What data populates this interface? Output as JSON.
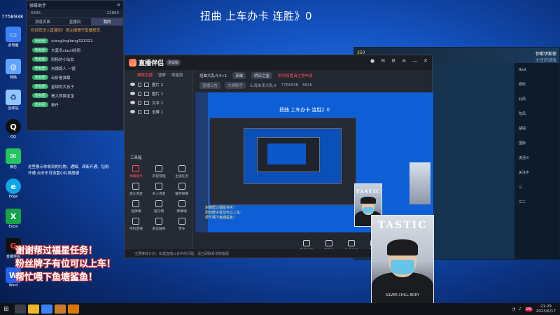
{
  "overlay": {
    "stream_title": "扭曲  上车办卡 连胜》0",
    "room_number_top": "7758938",
    "banner_lines": [
      "谢谢帮过福星任务！",
      "粉丝牌子有位可以上车！",
      "帮忙喂下鱼塘鲨鱼！"
    ]
  },
  "desktop_icons": [
    {
      "label": "此电脑",
      "icon": "computer-icon",
      "color": "#3b82f6"
    },
    {
      "label": "网络",
      "icon": "network-icon",
      "color": "#60a5fa"
    },
    {
      "label": "回收站",
      "icon": "recycle-bin-icon",
      "color": "#93c5fd"
    },
    {
      "label": "QQ",
      "icon": "qq-icon",
      "color": "#111111"
    },
    {
      "label": "微信",
      "icon": "wechat-icon",
      "color": "#22c55e"
    },
    {
      "label": "Edge",
      "icon": "edge-icon",
      "color": "#0ea5e9"
    },
    {
      "label": "Excel",
      "icon": "excel-icon",
      "color": "#16a34a"
    },
    {
      "label": "直播伴侣",
      "icon": "live-icon",
      "color": "#dc2626"
    },
    {
      "label": "Word",
      "icon": "word-icon",
      "color": "#2563eb"
    }
  ],
  "chat_panel": {
    "title": "弹幕助手",
    "stat_left": "6836",
    "stat_right": "22880",
    "tabs": [
      "消息页面",
      "直播间",
      "我的"
    ],
    "notice": "欢迎您进入直播间！请主播遵守直播规范",
    "items": [
      {
        "tag": "粉丝团",
        "text": "xiangjingliang321321"
      },
      {
        "tag": "粉丝团",
        "text": "大莫冬xiaoli晓雨"
      },
      {
        "tag": "粉丝团",
        "text": "雨杨的小仙女"
      },
      {
        "tag": "粉丝团",
        "text": "刘德路人 一镜"
      },
      {
        "tag": "粉丝团",
        "text": "玩虾看弹幕"
      },
      {
        "tag": "粉丝团",
        "text": "星球的大孩子"
      },
      {
        "tag": "粉丝团",
        "text": "看大熊猫宝宝"
      },
      {
        "tag": "粉丝团",
        "text": "泰丹"
      }
    ]
  },
  "notice_text": "这里展示你收到的礼物、通知、改新开通、钻粉开通 点击车可设置小礼物感谢",
  "app": {
    "name": "直播伴侣",
    "version": "测试版",
    "tabs": [
      "横屏直播",
      "竖屏",
      "明星版"
    ],
    "scenes": [
      "图片 2",
      "图片 1",
      "文本 1",
      "全屏 1"
    ],
    "tools_title": "工具箱",
    "tools": [
      "弹幕助手",
      "房管管理",
      "主播任务",
      "观众连麦",
      "多人连麦",
      "推荐弹幕",
      "送弹幕",
      "送礼物",
      "弹幕墙",
      "手机直播",
      "幸运抽奖",
      "更多"
    ],
    "room_title": "扭曲大乱斗4+1",
    "room_tag": "英雄",
    "room_extra": "明日之星",
    "room_warning": "房间设置请注意申请",
    "room_sub": [
      "直播公告",
      "大侠助手"
    ],
    "room_meta": "山海未来大乱斗",
    "room_id": "7758938",
    "viewers": "6836",
    "preview_title": "扭曲  上车办卡 连胜》0",
    "preview_msgs": [
      "谢谢帮过福星任务！",
      "粉丝牌子有位可以上车！",
      "帮忙喂下鱼塘鲨鱼！"
    ],
    "bottom_controls": [
      "直播屏幕",
      "摄像头",
      "手机投屏",
      "多媒体",
      "麦克风",
      "扬声器"
    ],
    "footer": "主要推荐计划：如遇直播公会中的问题，请立即联系专职客服"
  },
  "bg_window": {
    "score": "350",
    "name": "伊斯伊斯修",
    "sub": "大豆的游戏",
    "side_items": [
      "Rest",
      "即时",
      "北风",
      "吹风",
      "胡闹",
      "国际",
      "流活川",
      "关注乡",
      "三",
      "三二"
    ]
  },
  "cam": {
    "brand": "TASTIC",
    "bottom_text": "SILVER CHILL BODY"
  },
  "taskbar": {
    "time": "21:29",
    "date": "2023/6/17",
    "badge": "99"
  }
}
